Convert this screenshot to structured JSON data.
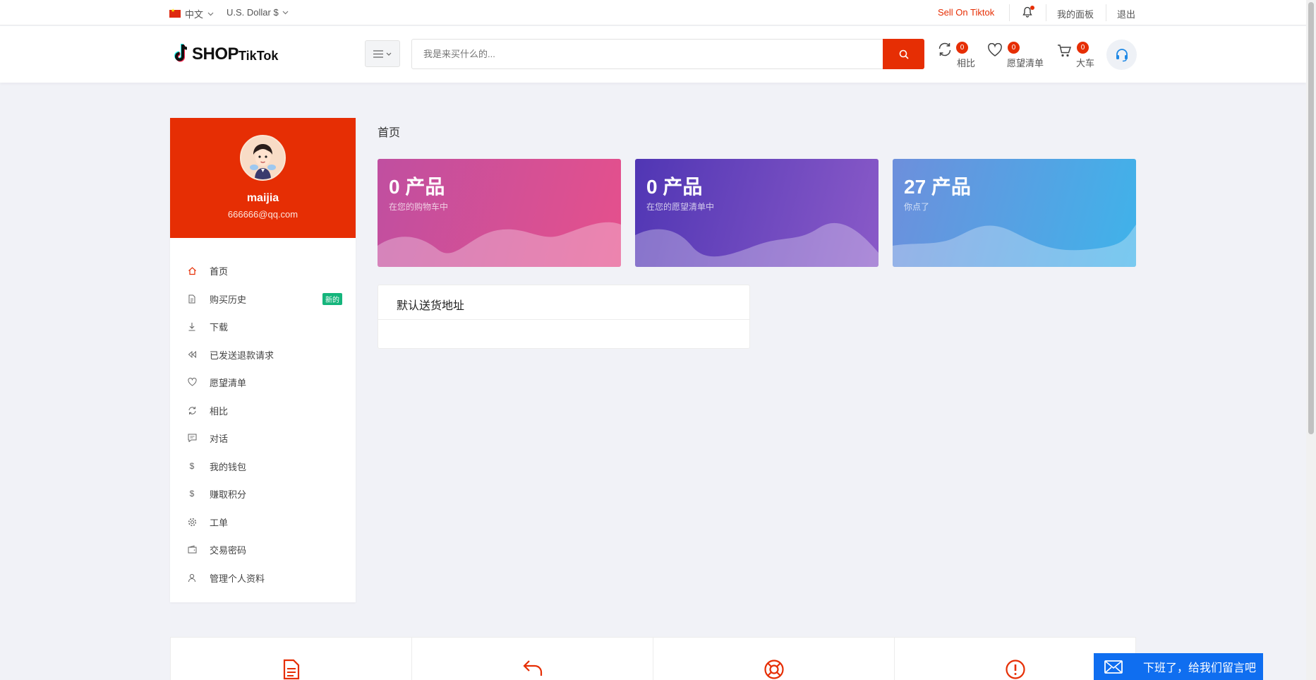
{
  "topbar": {
    "language": "中文",
    "currency": "U.S. Dollar $",
    "sell_link": "Sell On Tiktok",
    "dashboard_link": "我的面板",
    "logout_link": "退出"
  },
  "header": {
    "logo_shop": "SHOP",
    "logo_tiktok": "TikTok",
    "search_placeholder": "我是来买什么的...",
    "compare": {
      "count": "0",
      "label": "相比"
    },
    "wishlist": {
      "count": "0",
      "label": "愿望清单"
    },
    "cart": {
      "count": "0",
      "label": "大车"
    }
  },
  "profile": {
    "name": "maijia",
    "email": "666666@qq.com"
  },
  "nav": [
    {
      "label": "首页",
      "icon": "home-icon"
    },
    {
      "label": "购买历史",
      "icon": "file-icon",
      "badge": "新的"
    },
    {
      "label": "下载",
      "icon": "download-icon"
    },
    {
      "label": "已发送退款请求",
      "icon": "rewind-icon"
    },
    {
      "label": "愿望清单",
      "icon": "heart-icon"
    },
    {
      "label": "相比",
      "icon": "refresh-icon"
    },
    {
      "label": "对话",
      "icon": "message-icon"
    },
    {
      "label": "我的钱包",
      "icon": "dollar-icon"
    },
    {
      "label": "赚取积分",
      "icon": "dollar-icon"
    },
    {
      "label": "工单",
      "icon": "gear-icon"
    },
    {
      "label": "交易密码",
      "icon": "wallet-icon"
    },
    {
      "label": "管理个人资料",
      "icon": "user-icon"
    }
  ],
  "main": {
    "breadcrumb": "首页",
    "cards": [
      {
        "value": "0 产品",
        "caption": "在您的购物车中",
        "color_from": "#c04fa0",
        "color_to": "#e5508c"
      },
      {
        "value": "0 产品",
        "caption": "在您的愿望清单中",
        "color_from": "#5036b4",
        "color_to": "#8a5ac8"
      },
      {
        "value": "27 产品",
        "caption": "你点了",
        "color_from": "#6d8fdc",
        "color_to": "#3fb3ea"
      }
    ],
    "address_title": "默认送货地址"
  },
  "chat": {
    "label": "下班了，给我们留言吧"
  },
  "colors": {
    "brand": "#e62e04",
    "badge_new": "#15b57c",
    "chat": "#0f6ef0"
  }
}
